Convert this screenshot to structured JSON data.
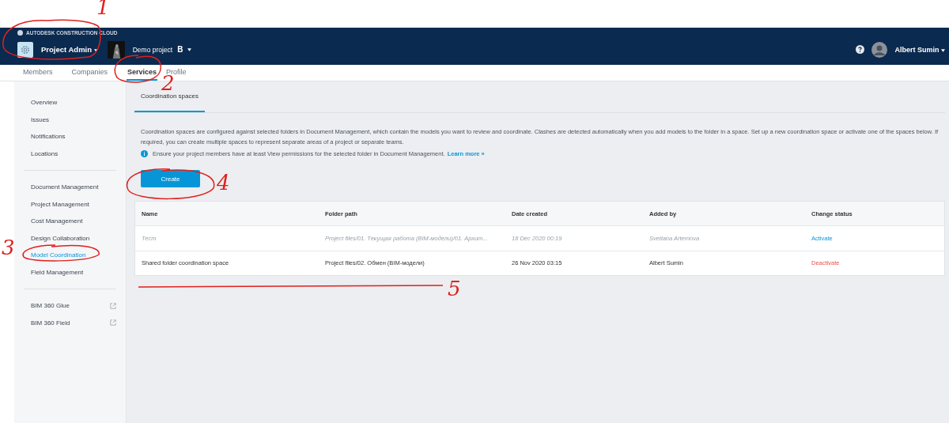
{
  "topbar": {
    "brand": "AUTODESK CONSTRUCTION CLOUD",
    "module": "Project Admin",
    "project": "Demo project",
    "project_badge": "B",
    "user": "Albert Sumin"
  },
  "tabs": [
    {
      "label": "Members",
      "selected": false
    },
    {
      "label": "Companies",
      "selected": false
    },
    {
      "label": "Services",
      "selected": true
    },
    {
      "label": "Profile",
      "selected": false
    }
  ],
  "sidebar": {
    "groups": [
      [
        {
          "label": "Overview",
          "selected": false,
          "external": false
        },
        {
          "label": "Issues",
          "selected": false,
          "external": false
        },
        {
          "label": "Notifications",
          "selected": false,
          "external": false
        },
        {
          "label": "Locations",
          "selected": false,
          "external": false
        }
      ],
      [
        {
          "label": "Document Management",
          "selected": false,
          "external": false
        },
        {
          "label": "Project Management",
          "selected": false,
          "external": false
        },
        {
          "label": "Cost Management",
          "selected": false,
          "external": false
        },
        {
          "label": "Design Collaboration",
          "selected": false,
          "external": false
        },
        {
          "label": "Model Coordination",
          "selected": true,
          "external": false
        },
        {
          "label": "Field Management",
          "selected": false,
          "external": false
        }
      ],
      [
        {
          "label": "BIM 360 Glue",
          "selected": false,
          "external": true
        },
        {
          "label": "BIM 360 Field",
          "selected": false,
          "external": true
        }
      ]
    ]
  },
  "subtab": {
    "label": "Coordination spaces",
    "selected": true
  },
  "description": "Coordination spaces are configured against selected folders in Document Management, which contain the models you want to review and coordinate. Clashes are detected automatically when you add models to the folder in a space. Set up a new coordination space or activate one of the spaces below. If required, you can create multiple spaces to represent separate areas of a project or separate teams.",
  "info": {
    "text": "Ensure your project members have at least View permissions for the selected folder in Document Management.",
    "link": "Learn more »"
  },
  "create_button": "Create",
  "table": {
    "columns": [
      "Name",
      "Folder path",
      "Date created",
      "Added by",
      "Change status"
    ],
    "rows": [
      {
        "name": "Тест",
        "folder_path": "Project files/01. Текущая работа (BIM-модели)/01. Архит...",
        "date_created": "18 Dec 2020 00:19",
        "added_by": "Svetlana Artemova",
        "action": "Activate",
        "active": false
      },
      {
        "name": "Shared folder coordination space",
        "folder_path": "Project files/02. Обмен (BIM-модели)",
        "date_created": "26 Nov 2020 03:15",
        "added_by": "Albert Sumin",
        "action": "Deactivate",
        "active": true
      }
    ]
  },
  "annotations": [
    {
      "label": "1"
    },
    {
      "label": "2"
    },
    {
      "label": "3"
    },
    {
      "label": "4"
    },
    {
      "label": "5"
    }
  ]
}
